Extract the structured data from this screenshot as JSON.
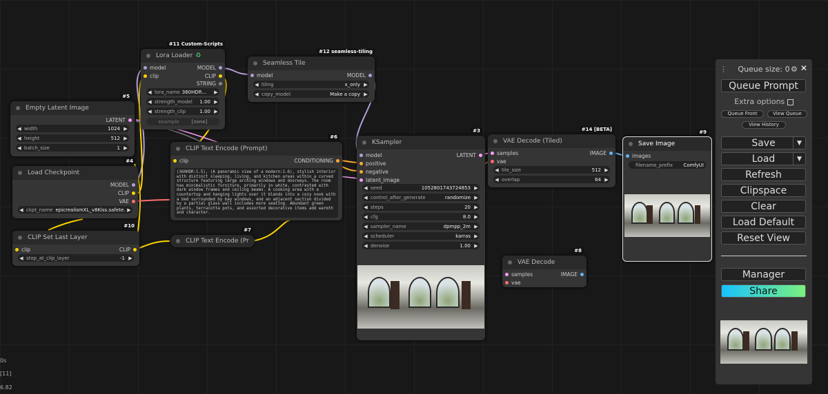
{
  "nodes": {
    "empty_latent": {
      "badge": "#5",
      "title": "Empty Latent Image",
      "out_latent": "LATENT",
      "widgets": [
        {
          "label": "width",
          "value": "1024"
        },
        {
          "label": "height",
          "value": "512"
        },
        {
          "label": "batch_size",
          "value": "1"
        }
      ]
    },
    "load_checkpoint": {
      "badge": "#4",
      "title": "Load Checkpoint",
      "out_model": "MODEL",
      "out_clip": "CLIP",
      "out_vae": "VAE",
      "widget": {
        "label": "ckpt_name",
        "value": "epicrealismXL_v8Kiss.safete..."
      }
    },
    "clip_last_layer": {
      "badge": "#10",
      "title": "CLIP Set Last Layer",
      "in_clip": "clip",
      "out_clip": "CLIP",
      "widget": {
        "label": "stop_at_clip_layer",
        "value": "-1"
      }
    },
    "lora_loader": {
      "badge": "#11 Custom-Scripts",
      "title": "Lora Loader",
      "in_model": "model",
      "in_clip": "clip",
      "out_model": "MODEL",
      "out_clip": "CLIP",
      "out_string": "STRING",
      "widgets": [
        {
          "label": "lora_name",
          "value": "360HDR..."
        },
        {
          "label": "strength_model",
          "value": "1.00"
        },
        {
          "label": "strength_clip",
          "value": "1.00"
        }
      ],
      "example_label": "example",
      "example_value": "[none]"
    },
    "seamless_tile": {
      "badge": "#12 seamless-tiling",
      "title": "Seamless Tile",
      "in_model": "model",
      "out_model": "MODEL",
      "widgets": [
        {
          "label": "tiling",
          "value": "x_only"
        },
        {
          "label": "copy_model",
          "value": "Make a copy"
        }
      ]
    },
    "clip_encode_pos": {
      "badge": "#6",
      "title": "CLIP Text Encode (Prompt)",
      "in_clip": "clip",
      "out_conditioning": "CONDITIONING",
      "text": "(360HDR:1.5), (A panoramic view of a modern:1.6), stylish interior with distinct sleeping, living, and kitchen areas within a curved structure featuring large arching windows and doorways. The room has minimalistic furniture, primarily in white, contrasted with dark window frames and ceiling beams. A cooking area with a countertop and hanging lights over it blends into a cozy nook with a bed surrounded by bay windows, and an adjacent section divided by a partial glass wall includes more seating. Abundant green plants, terracotta pots, and assorted decorative items add warmth and character."
    },
    "clip_encode_neg": {
      "badge": "#7",
      "title": "CLIP Text Encode (Pr"
    },
    "ksampler": {
      "badge": "#3",
      "title": "KSampler",
      "in_model": "model",
      "in_positive": "positive",
      "in_negative": "negative",
      "in_latent": "latent_image",
      "out_latent": "LATENT",
      "widgets": [
        {
          "label": "seed",
          "value": "1052801743724853"
        },
        {
          "label": "control_after_generate",
          "value": "randomize"
        },
        {
          "label": "steps",
          "value": "20"
        },
        {
          "label": "cfg",
          "value": "8.0"
        },
        {
          "label": "sampler_name",
          "value": "dpmpp_2m"
        },
        {
          "label": "scheduler",
          "value": "karras"
        },
        {
          "label": "denoise",
          "value": "1.00"
        }
      ]
    },
    "vae_decode_tiled": {
      "badge": "#14 [BETA]",
      "title": "VAE Decode (Tiled)",
      "in_samples": "samples",
      "in_vae": "vae",
      "out_image": "IMAGE",
      "widgets": [
        {
          "label": "tile_size",
          "value": "512"
        },
        {
          "label": "overlap",
          "value": "64"
        }
      ]
    },
    "vae_decode": {
      "badge": "#8",
      "title": "VAE Decode",
      "in_samples": "samples",
      "in_vae": "vae",
      "out_image": "IMAGE"
    },
    "save_image": {
      "badge": "#9",
      "title": "Save Image",
      "in_images": "images",
      "widget": {
        "label": "filename_prefix",
        "value": "ComfyUI"
      }
    }
  },
  "panel": {
    "queue_size": "Queue size: 0",
    "queue_prompt": "Queue Prompt",
    "extra_options": "Extra options",
    "queue_front": "Queue Front",
    "view_queue": "View Queue",
    "view_history": "View History",
    "save": "Save",
    "load": "Load",
    "refresh": "Refresh",
    "clipspace": "Clipspace",
    "clear": "Clear",
    "load_default": "Load Default",
    "reset_view": "Reset View",
    "manager": "Manager",
    "share": "Share"
  },
  "stats": {
    "line1": "0s",
    "line2": "[11]",
    "line3": "6.82"
  },
  "colors": {
    "model": "#b39ddb",
    "clip": "#ffd500",
    "vae": "#ff6e6e",
    "conditioning": "#ffa931",
    "latent": "#ff9cf9",
    "image": "#64b5f6",
    "accent": "#18c2ff"
  }
}
